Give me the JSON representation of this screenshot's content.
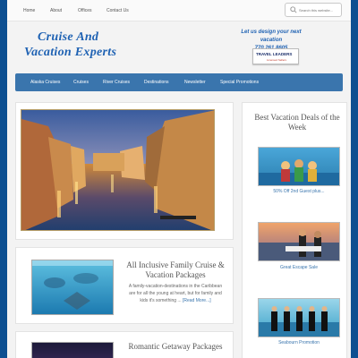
{
  "topnav": {
    "items": [
      "Home",
      "About",
      "Offices",
      "Contact Us"
    ],
    "search_placeholder": "Search this website..."
  },
  "header": {
    "logo_line1": "Cruise And",
    "logo_line2": "Vacation Experts",
    "tagline": "Let us design your next vacation",
    "phone": "770.261.8605",
    "badge_main": "TRAVEL LEADERS",
    "badge_sub": "Licensed Sellers"
  },
  "mainnav": {
    "items": [
      "Alaska Cruises",
      "Cruises",
      "River Cruises",
      "Destinations",
      "Newsletter",
      "Special Promotions"
    ]
  },
  "articles": [
    {
      "title_line1": "All Inclusive Family Cruise &",
      "title_line2": "Vacation Packages",
      "body_line1": "A family-vacation-destinations in the Caribbean",
      "body_line2": "are for all the young at heart, but for family and",
      "body_line3": "kids it's something ...",
      "read_more": "[Read More...]"
    },
    {
      "title": "Romantic Getaway Packages"
    }
  ],
  "sidebar": {
    "title": "Best Vacation Deals of the Week",
    "deals": [
      {
        "label": "50% Off 2nd Guest plus..."
      },
      {
        "label": "Great Escape Sale"
      },
      {
        "label": "Seabourn Promotion"
      }
    ]
  },
  "colors": {
    "background": "#0d4f91",
    "nav": "#3a75ad",
    "brand": "#1f62b3"
  }
}
